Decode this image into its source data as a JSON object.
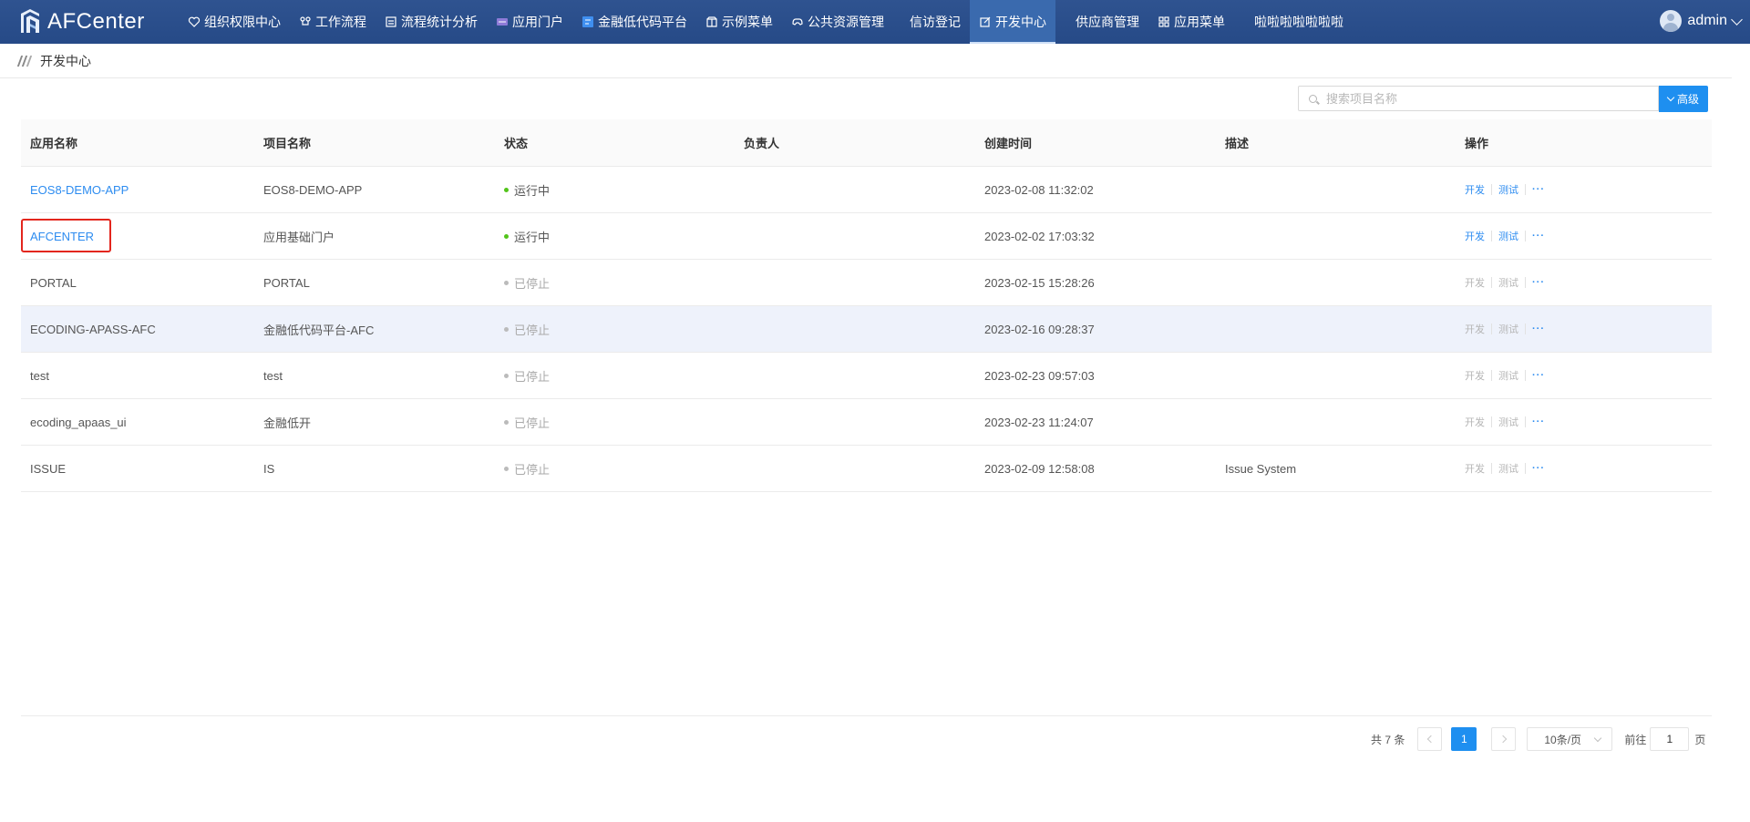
{
  "app": {
    "title": "AFCenter"
  },
  "nav": {
    "items": [
      {
        "label": "组织权限中心",
        "icon": "heart-shield-icon"
      },
      {
        "label": "工作流程",
        "icon": "workflow-icon"
      },
      {
        "label": "流程统计分析",
        "icon": "stats-icon"
      },
      {
        "label": "应用门户",
        "icon": "portal-icon"
      },
      {
        "label": "金融低代码平台",
        "icon": "lowcode-icon"
      },
      {
        "label": "示例菜单",
        "icon": "box-icon"
      },
      {
        "label": "公共资源管理",
        "icon": "gamepad-icon"
      },
      {
        "label": "信访登记",
        "icon": ""
      },
      {
        "label": "开发中心",
        "icon": "edit-icon",
        "active": true
      },
      {
        "label": "供应商管理",
        "icon": ""
      },
      {
        "label": "应用菜单",
        "icon": "grid-icon"
      },
      {
        "label": "啦啦啦啦啦啦啦",
        "icon": ""
      }
    ]
  },
  "user": {
    "name": "admin"
  },
  "breadcrumb": {
    "current": "开发中心"
  },
  "search": {
    "placeholder": "搜索项目名称",
    "value": ""
  },
  "advanced_label": "高级",
  "table": {
    "headers": [
      "应用名称",
      "项目名称",
      "状态",
      "负责人",
      "创建时间",
      "描述",
      "操作"
    ],
    "op_dev": "开发",
    "op_test": "测试",
    "op_more": "···",
    "rows": [
      {
        "app": "EOS8-DEMO-APP",
        "project": "EOS8-DEMO-APP",
        "status": "运行中",
        "running": true,
        "owner": "",
        "created": "2023-02-08 11:32:02",
        "desc": ""
      },
      {
        "app": "AFCENTER",
        "project": "应用基础门户",
        "status": "运行中",
        "running": true,
        "owner": "",
        "created": "2023-02-02 17:03:32",
        "desc": ""
      },
      {
        "app": "PORTAL",
        "project": "PORTAL",
        "status": "已停止",
        "running": false,
        "owner": "",
        "created": "2023-02-15 15:28:26",
        "desc": ""
      },
      {
        "app": "ECODING-APASS-AFC",
        "project": "金融低代码平台-AFC",
        "status": "已停止",
        "running": false,
        "owner": "",
        "created": "2023-02-16 09:28:37",
        "desc": ""
      },
      {
        "app": "test",
        "project": "test",
        "status": "已停止",
        "running": false,
        "owner": "",
        "created": "2023-02-23 09:57:03",
        "desc": ""
      },
      {
        "app": "ecoding_apaas_ui",
        "project": "金融低开",
        "status": "已停止",
        "running": false,
        "owner": "",
        "created": "2023-02-23 11:24:07",
        "desc": ""
      },
      {
        "app": "ISSUE",
        "project": "IS",
        "status": "已停止",
        "running": false,
        "owner": "",
        "created": "2023-02-09 12:58:08",
        "desc": "Issue System"
      }
    ]
  },
  "pagination": {
    "total_text": "共 7 条",
    "current_page": "1",
    "page_size": "10条/页",
    "goto_label": "前往",
    "goto_value": "1",
    "page_unit": "页"
  },
  "colors": {
    "topbar": "#2b4f8c",
    "accent": "#1e8ff0",
    "link": "#2d8cf0",
    "running": "#52c41a",
    "highlight_box": "#e3261d"
  }
}
